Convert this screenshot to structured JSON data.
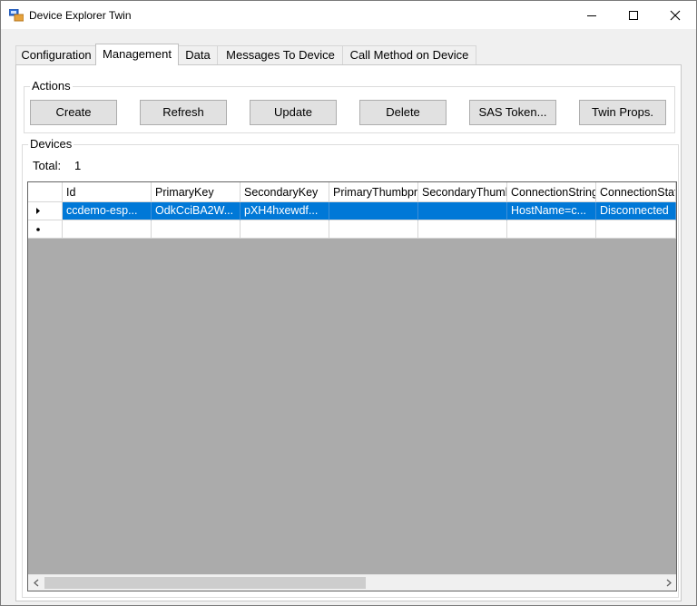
{
  "window": {
    "title": "Device Explorer Twin"
  },
  "tabs": [
    {
      "label": "Configuration"
    },
    {
      "label": "Management"
    },
    {
      "label": "Data"
    },
    {
      "label": "Messages To Device"
    },
    {
      "label": "Call Method on Device"
    }
  ],
  "actions": {
    "title": "Actions",
    "buttons": [
      {
        "label": "Create"
      },
      {
        "label": "Refresh"
      },
      {
        "label": "Update"
      },
      {
        "label": "Delete"
      },
      {
        "label": "SAS Token..."
      },
      {
        "label": "Twin Props."
      }
    ]
  },
  "devices": {
    "title": "Devices",
    "total_label": "Total:",
    "total_value": "1",
    "columns": [
      "Id",
      "PrimaryKey",
      "SecondaryKey",
      "PrimaryThumbprint",
      "SecondaryThumbprint",
      "ConnectionString",
      "ConnectionState"
    ],
    "rows": [
      [
        "ccdemo-esp...",
        "OdkCciBA2W...",
        "pXH4hxewdf...",
        "",
        "",
        "HostName=c...",
        "Disconnected"
      ]
    ]
  },
  "colors": {
    "selection": "#0078d7",
    "grid_background": "#ababab"
  },
  "icons": [
    "app-icon",
    "minimize-icon",
    "maximize-icon",
    "close-icon",
    "current-row-arrow-icon",
    "new-row-asterisk-icon",
    "scroll-left-icon",
    "scroll-right-icon"
  ]
}
